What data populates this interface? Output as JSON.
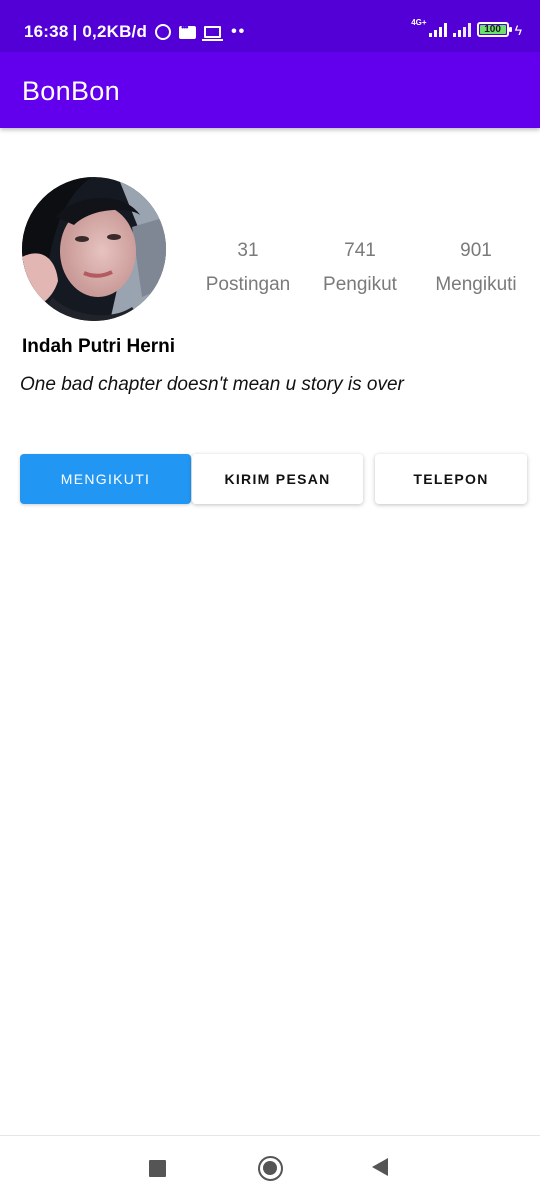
{
  "status_bar": {
    "time": "16:38",
    "speed": "| 0,2KB/d",
    "network": "4G+",
    "battery": "100",
    "icons": [
      "alarm-icon",
      "message-icon",
      "laptop-icon",
      "more-dots-icon",
      "signal-icon",
      "signal-icon",
      "battery-icon",
      "charging-icon"
    ]
  },
  "app_bar": {
    "title": "BonBon"
  },
  "profile": {
    "avatar": "profile-photo",
    "stats": [
      {
        "value": "31",
        "label": "Postingan"
      },
      {
        "value": "741",
        "label": "Pengikut"
      },
      {
        "value": "901",
        "label": "Mengikuti"
      }
    ],
    "name": "Indah Putri Herni",
    "bio": "One bad chapter doesn't mean u story is over"
  },
  "actions": {
    "follow": "MENGIKUTI",
    "message": "KIRIM PESAN",
    "call": "TELEPON"
  },
  "colors": {
    "status_bar": "#5200d6",
    "app_bar": "#6200ee",
    "primary_button": "#2196f3"
  },
  "nav_bar": {
    "icons": [
      "recents-icon",
      "home-icon",
      "back-icon"
    ]
  }
}
